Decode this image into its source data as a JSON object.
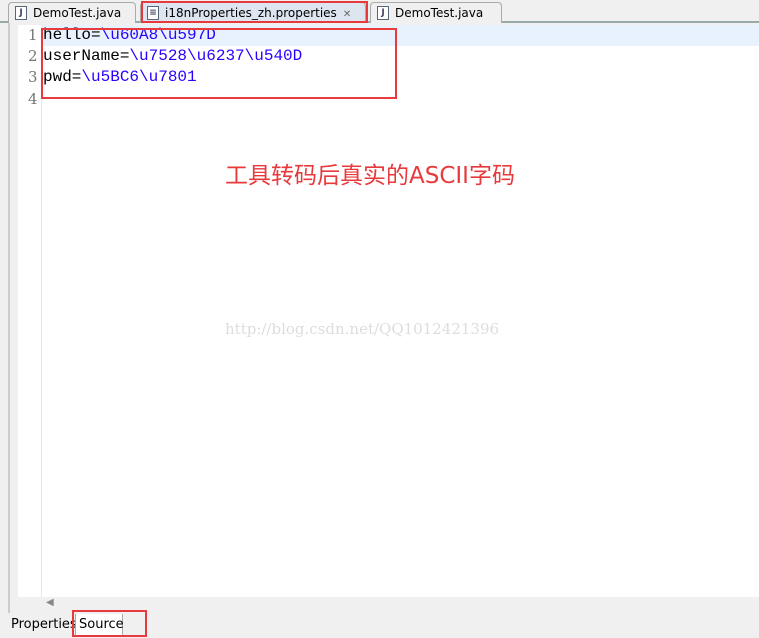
{
  "tabs": [
    {
      "label": "DemoTest.java",
      "icon": "java-file-icon"
    },
    {
      "label": "i18nProperties_zh.properties",
      "icon": "properties-file-icon",
      "active": true
    },
    {
      "label": "DemoTest.java",
      "icon": "java-file-icon"
    }
  ],
  "editor": {
    "lines": [
      {
        "num": "1",
        "key": "hello=",
        "value": "\\u60A8\\u597D"
      },
      {
        "num": "2",
        "key": "userName=",
        "value": "\\u7528\\u6237\\u540D"
      },
      {
        "num": "3",
        "key": "pwd=",
        "value": "\\u5BC6\\u7801"
      },
      {
        "num": "4",
        "key": "",
        "value": ""
      }
    ]
  },
  "annotation": "工具转码后真实的ASCII字码",
  "watermark": "http://blog.csdn.net/QQ1012421396",
  "bottom_tabs": [
    {
      "label": "Properties"
    },
    {
      "label": "Source",
      "active": true
    }
  ],
  "colors": {
    "highlight": "#e8393c",
    "value": "#2a00ff",
    "current_line": "#e8f2fe"
  }
}
